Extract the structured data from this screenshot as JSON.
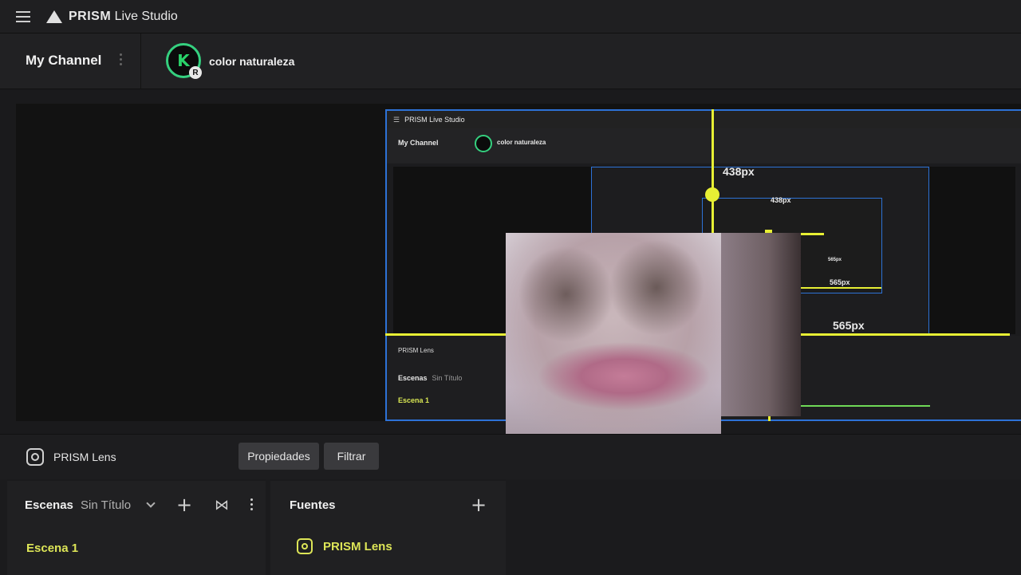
{
  "app": {
    "name_bold": "PRISM",
    "name_rest": " Live Studio"
  },
  "channel": {
    "title": "My Channel",
    "name": "color naturaleza",
    "avatar_letter": "K",
    "avatar_badge": "R"
  },
  "preview": {
    "nested_app_name": "PRISM Live Studio",
    "nested_channel_title": "My Channel",
    "nested_channel_name": "color naturaleza",
    "nested_lens": "PRISM Lens",
    "nested_scenes": "Escenas",
    "nested_untitled": "Sin Título",
    "nested_scene1": "Escena 1",
    "dim_height_1": "438px",
    "dim_height_2": "438px",
    "dim_width_1": "565px",
    "dim_width_2": "565px",
    "dim_width_3": "565px"
  },
  "lens": {
    "label": "PRISM Lens",
    "properties_button": "Propiedades",
    "filter_button": "Filtrar"
  },
  "scenes": {
    "title": "Escenas",
    "collection": "Sin Título",
    "items": [
      "Escena 1"
    ]
  },
  "sources": {
    "title": "Fuentes",
    "items": [
      "PRISM Lens"
    ]
  },
  "colors": {
    "accent_yellow": "#dde557",
    "guide_yellow": "#e7ef34",
    "selection_blue": "#2d72d6",
    "avatar_green": "#35d07f"
  },
  "icons": [
    "hamburger-icon",
    "prism-logo-icon",
    "kebab-icon",
    "lens-icon",
    "plus-icon",
    "transition-icon",
    "chevron-down-icon"
  ]
}
